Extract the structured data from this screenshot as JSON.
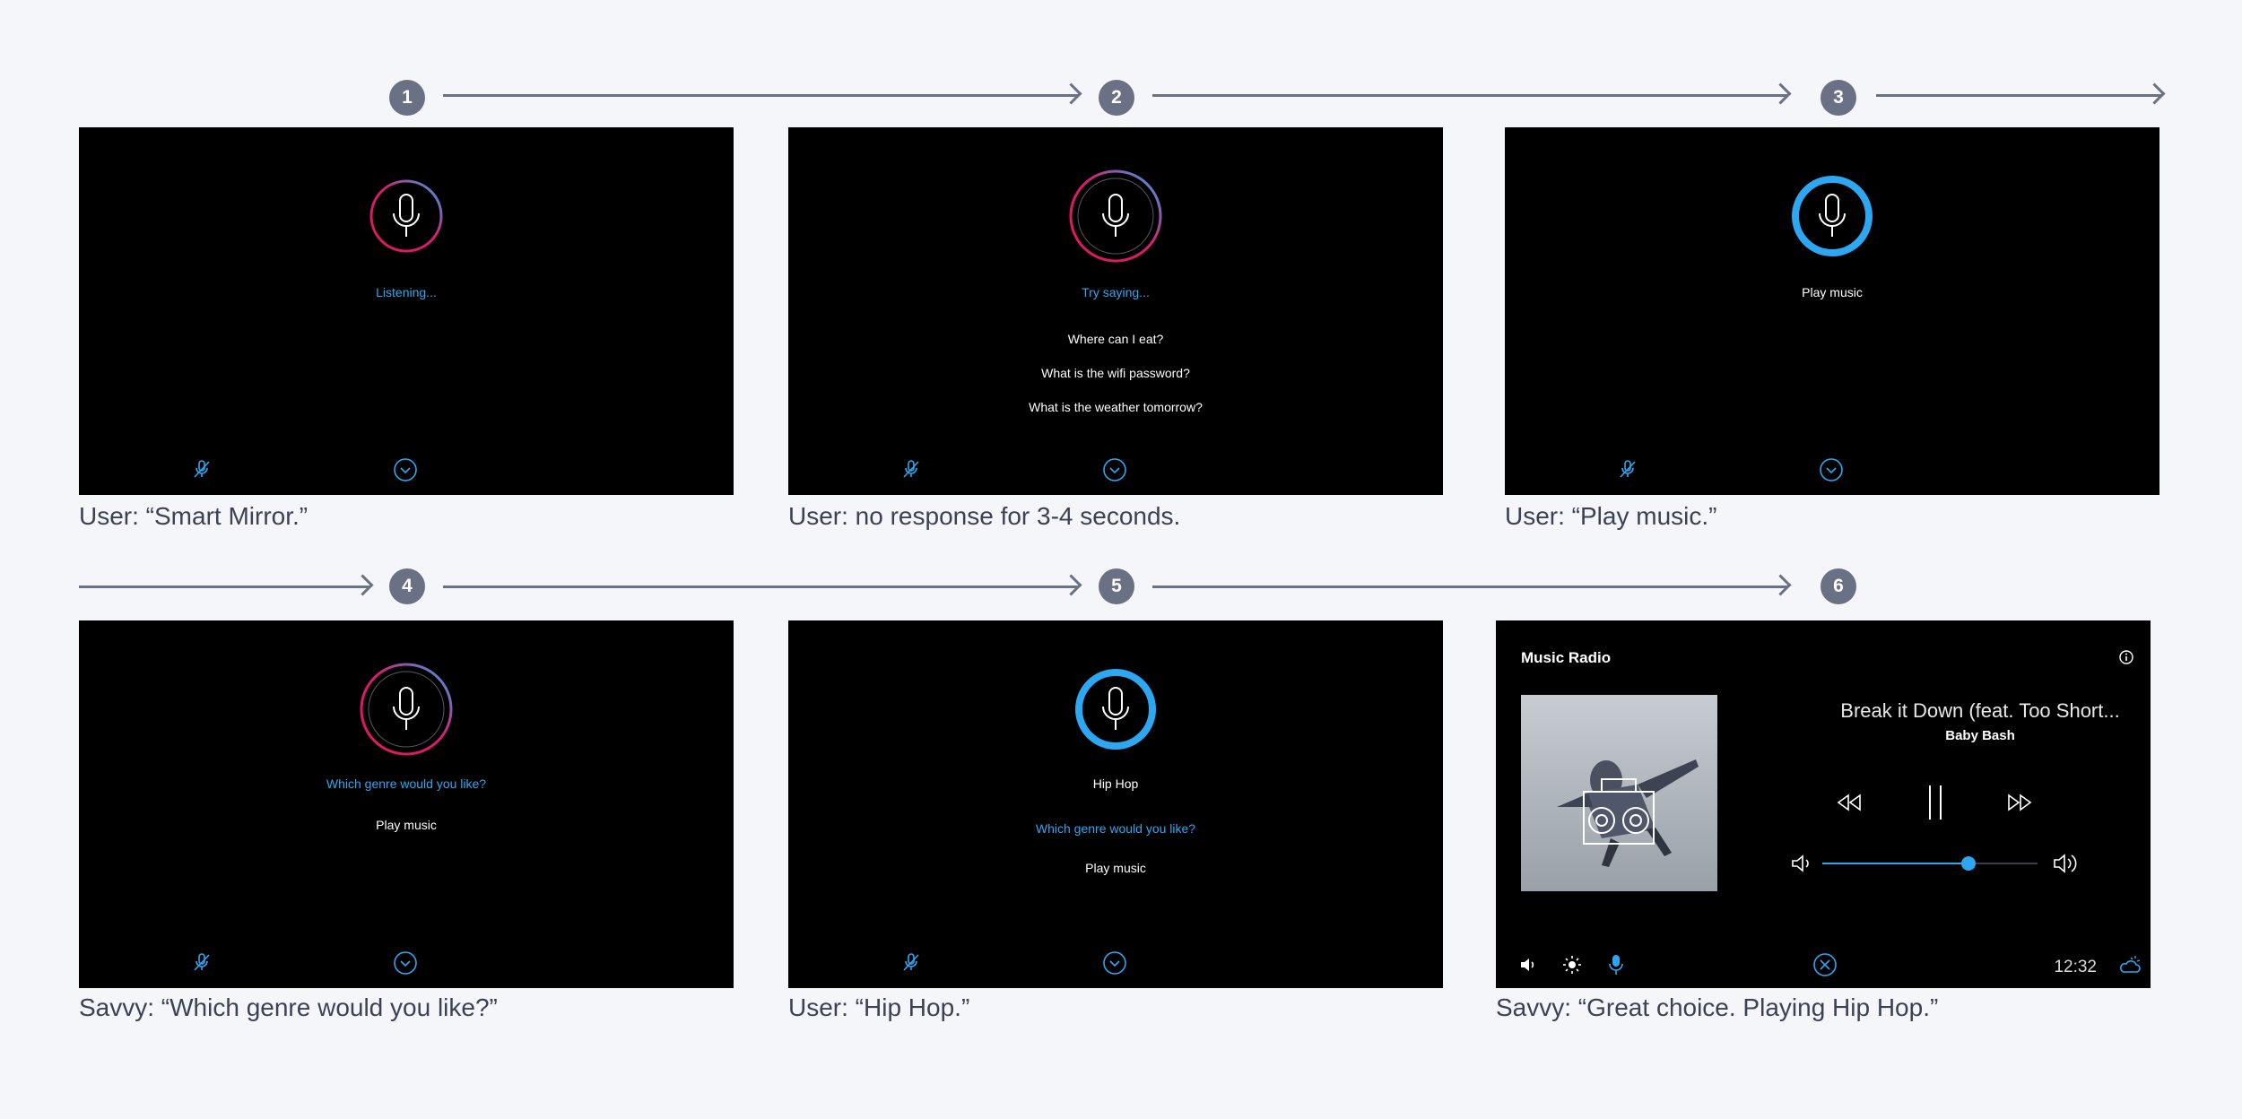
{
  "colors": {
    "page_bg": "#f4f6fa",
    "connector": "#6b7184",
    "screen_bg": "#000000",
    "accent_blue": "#2ea7f2",
    "accent_pink": "#e0185e",
    "caption_text": "#3c4254"
  },
  "steps": [
    {
      "number": "1",
      "caption": "User: “Smart Mirror.”",
      "mic_state": "gradient-ring",
      "lines": [
        {
          "text": "Listening...",
          "style": "blue"
        }
      ],
      "footer_icons": [
        "mic-off-icon",
        "chevron-down-icon"
      ]
    },
    {
      "number": "2",
      "caption": "User: no response for 3-4 seconds.",
      "mic_state": "double-gradient-ring",
      "lines": [
        {
          "text": "Try saying...",
          "style": "blue"
        },
        {
          "text": "Where can I eat?",
          "style": "white"
        },
        {
          "text": "What is the wifi password?",
          "style": "white"
        },
        {
          "text": "What is the weather tomorrow?",
          "style": "white"
        }
      ],
      "footer_icons": [
        "mic-off-icon",
        "chevron-down-icon"
      ]
    },
    {
      "number": "3",
      "caption": "User: “Play music.”",
      "mic_state": "solid-blue-ring",
      "lines": [
        {
          "text": "Play music",
          "style": "white"
        }
      ],
      "footer_icons": [
        "mic-off-icon",
        "chevron-down-icon"
      ]
    },
    {
      "number": "4",
      "caption": "Savvy: “Which genre would you like?”",
      "mic_state": "double-gradient-ring",
      "lines": [
        {
          "text": "Which genre would you like?",
          "style": "blue"
        },
        {
          "text": "Play music",
          "style": "white"
        }
      ],
      "footer_icons": [
        "mic-off-icon",
        "chevron-down-icon"
      ]
    },
    {
      "number": "5",
      "caption": "User: “Hip Hop.”",
      "mic_state": "solid-blue-ring",
      "lines": [
        {
          "text": "Hip Hop",
          "style": "white"
        },
        {
          "text": "Which genre would you like?",
          "style": "blue"
        },
        {
          "text": "Play music",
          "style": "white"
        }
      ],
      "footer_icons": [
        "mic-off-icon",
        "chevron-down-icon"
      ]
    },
    {
      "number": "6",
      "caption": "Savvy: “Great choice. Playing Hip Hop.”",
      "music_player": {
        "title": "Music Radio",
        "track": "Break it Down (feat. Too Short...",
        "artist": "Baby Bash",
        "volume": 0.68,
        "time": "12:32",
        "icons": [
          "info-icon",
          "rewind-icon",
          "pause-icon",
          "fast-forward-icon",
          "volume-low-icon",
          "volume-high-icon",
          "speaker-icon",
          "brightness-icon",
          "mic-icon",
          "close-icon",
          "weather-icon"
        ]
      }
    }
  ]
}
